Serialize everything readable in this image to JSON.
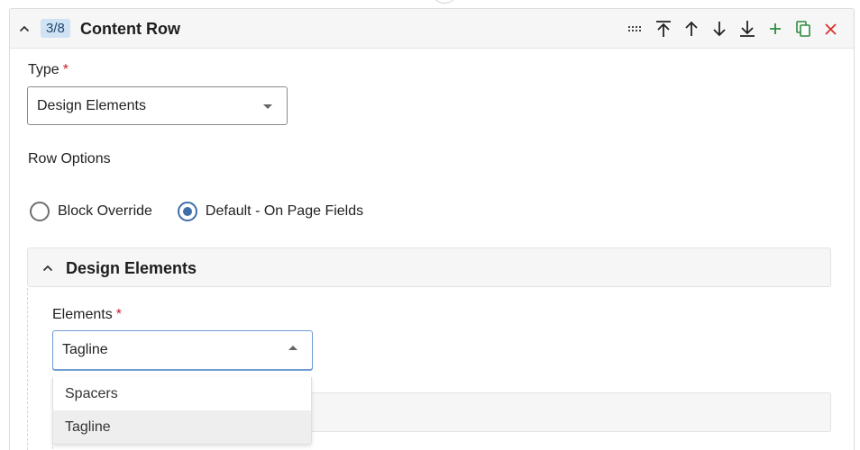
{
  "header": {
    "badge": "3/8",
    "title": "Content Row"
  },
  "type_field": {
    "label": "Type",
    "required_mark": "*",
    "value": "Design Elements"
  },
  "row_options": {
    "label": "Row Options",
    "options": [
      {
        "label": "Block Override",
        "checked": false
      },
      {
        "label": "Default - On Page Fields",
        "checked": true
      }
    ]
  },
  "design_elements": {
    "title": "Design Elements",
    "elements_field": {
      "label": "Elements",
      "required_mark": "*",
      "value": "Tagline",
      "options": [
        "Spacers",
        "Tagline"
      ],
      "highlighted": "Tagline"
    }
  },
  "toolbar": {
    "icons": [
      "drag-handle-icon",
      "move-to-top-icon",
      "move-up-icon",
      "move-down-icon",
      "move-to-bottom-icon",
      "add-icon",
      "duplicate-icon",
      "delete-icon"
    ]
  },
  "colors": {
    "accent": "#3f6ea8",
    "badge_bg": "#cfe3f5",
    "add_green": "#2e8b3e",
    "delete_red": "#d9312a",
    "required_red": "#c8202a"
  }
}
